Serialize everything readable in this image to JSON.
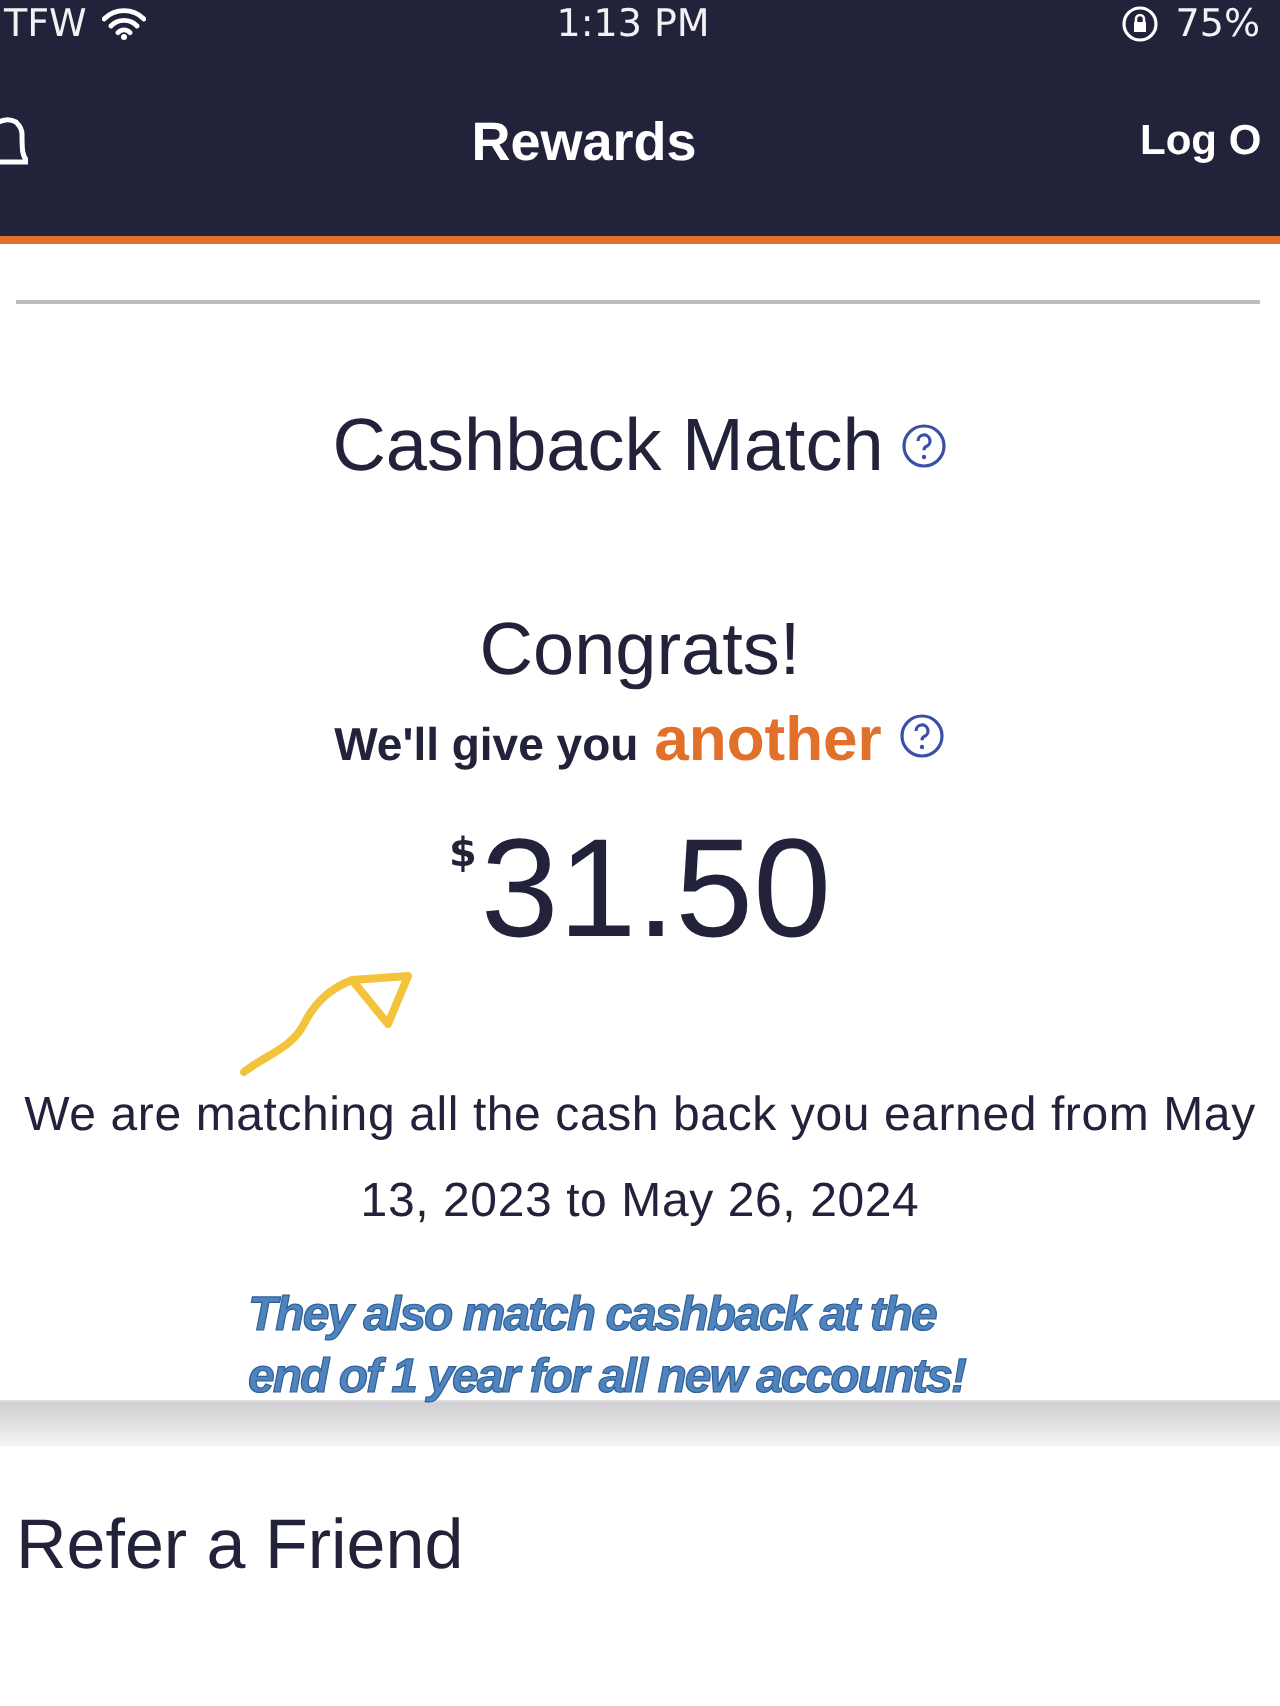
{
  "status_bar": {
    "carrier": "TFW",
    "time": "1:13 PM",
    "battery": "75%"
  },
  "nav": {
    "title": "Rewards",
    "action": "Log O"
  },
  "cashback": {
    "title": "Cashback Match",
    "headline": "Congrats!",
    "subline": "We'll give you",
    "highlight": "another",
    "currency": "$",
    "amount": "31.50",
    "description": "We are matching all the cash back you earned from May 13, 2023 to May 26, 2024"
  },
  "annotation": "They also match cashback at the end of 1 year for all new accounts!",
  "refer": {
    "title": "Refer a Friend"
  }
}
